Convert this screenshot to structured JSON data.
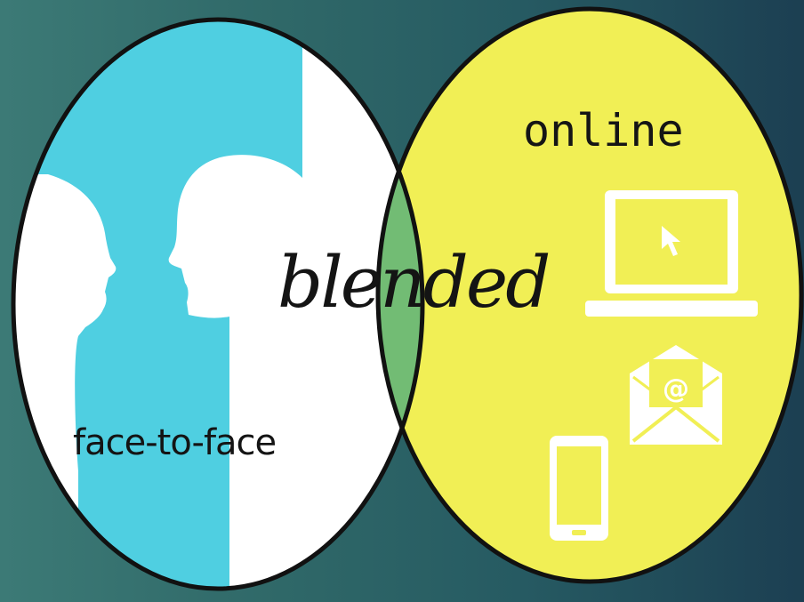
{
  "diagram": {
    "online_label": "online",
    "blended_label": "blended",
    "face_to_face_label": "face-to-face",
    "colors": {
      "face_to_face": "#4fcfe1",
      "online": "#f1ef55",
      "blended": "#72bc74",
      "background_left": "#3c7a76",
      "background_right": "#1c3f52",
      "outline": "#111111"
    },
    "icons": [
      "faces-silhouette-icon",
      "laptop-icon",
      "email-icon",
      "smartphone-icon"
    ]
  }
}
